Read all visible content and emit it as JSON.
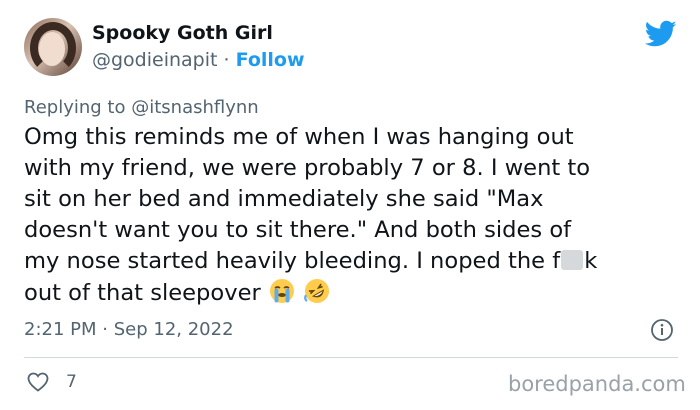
{
  "author": {
    "display_name": "Spooky Goth Girl",
    "handle": "@godieinapit",
    "separator": "·",
    "follow_label": "Follow"
  },
  "reply": {
    "prefix": "Replying to",
    "mention": "@itsnashflynn"
  },
  "tweet": {
    "lines": [
      "Omg this reminds me of when I was hanging out",
      "with my friend, we were probably 7 or 8. I went to",
      "sit on her bed and immediately she said \"Max",
      "doesn't want you to sit there.\" And both sides of"
    ],
    "line5_before_censor": "my nose started heavily bleeding. I noped the f",
    "line5_after_censor": "k",
    "line6": "out of that sleepover",
    "emojis": [
      "loudly-crying-face",
      "rolling-on-floor-laughing"
    ]
  },
  "meta": {
    "time": "2:21 PM",
    "separator": "·",
    "date": "Sep 12, 2022"
  },
  "actions": {
    "like_count": "7"
  },
  "watermark": "boredpanda.com",
  "colors": {
    "twitter_blue": "#1d9bf0",
    "text_primary": "#0f1419",
    "text_secondary": "#536471",
    "divider": "#cfd9de",
    "watermark": "#98a2a8"
  },
  "icons": {
    "brand": "twitter-bird-icon",
    "info": "info-icon",
    "like": "heart-icon"
  }
}
